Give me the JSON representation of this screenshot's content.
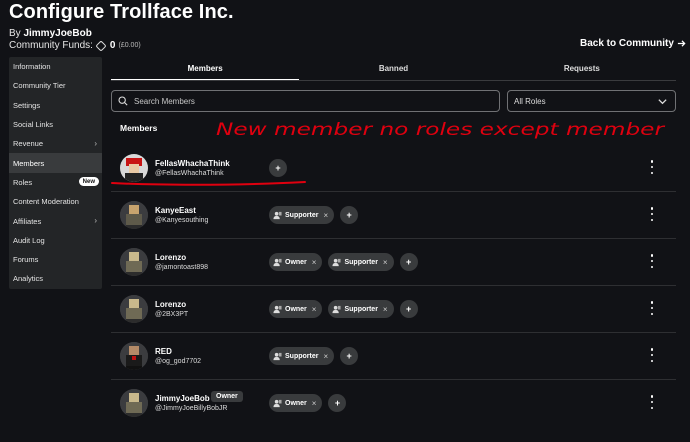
{
  "header": {
    "title": "Configure Trollface Inc.",
    "by_prefix": "By",
    "owner_name": "JimmyJoeBob",
    "funds_label": "Community Funds:",
    "funds_amount": "0",
    "funds_sub": "(£0.00)",
    "back_label": "Back to Community"
  },
  "sidebar": {
    "items": [
      {
        "label": "Information"
      },
      {
        "label": "Community Tier"
      },
      {
        "label": "Settings"
      },
      {
        "label": "Social Links"
      },
      {
        "label": "Revenue"
      },
      {
        "label": "Members"
      },
      {
        "label": "Roles",
        "badge": "New"
      },
      {
        "label": "Content Moderation"
      },
      {
        "label": "Affiliates"
      },
      {
        "label": "Audit Log"
      },
      {
        "label": "Forums"
      },
      {
        "label": "Analytics"
      }
    ]
  },
  "tabs": [
    {
      "label": "Members"
    },
    {
      "label": "Banned"
    },
    {
      "label": "Requests"
    }
  ],
  "search": {
    "placeholder": "Search Members",
    "role_filter": "All Roles"
  },
  "members_heading": "Members",
  "annotation": "New member no roles except member",
  "members": [
    {
      "name": "FellasWhachaThink",
      "handle": "@FellasWhachaThink",
      "roles": []
    },
    {
      "name": "KanyeEast",
      "handle": "@Kanyesouthing",
      "roles": [
        "Supporter"
      ]
    },
    {
      "name": "Lorenzo",
      "handle": "@jamontoast898",
      "roles": [
        "Owner",
        "Supporter"
      ]
    },
    {
      "name": "Lorenzo",
      "handle": "@2BX3PT",
      "roles": [
        "Owner",
        "Supporter"
      ]
    },
    {
      "name": "RED",
      "handle": "@og_god7702",
      "roles": [
        "Supporter"
      ]
    },
    {
      "name": "JimmyJoeBob",
      "handle": "@JimmyJoeBillyBobJR",
      "tag": "Owner",
      "roles": [
        "Owner"
      ]
    }
  ],
  "colors": {
    "background": "#111216",
    "sidebar": "#232527",
    "chip": "#393b3d",
    "annotation": "#e0000f"
  }
}
